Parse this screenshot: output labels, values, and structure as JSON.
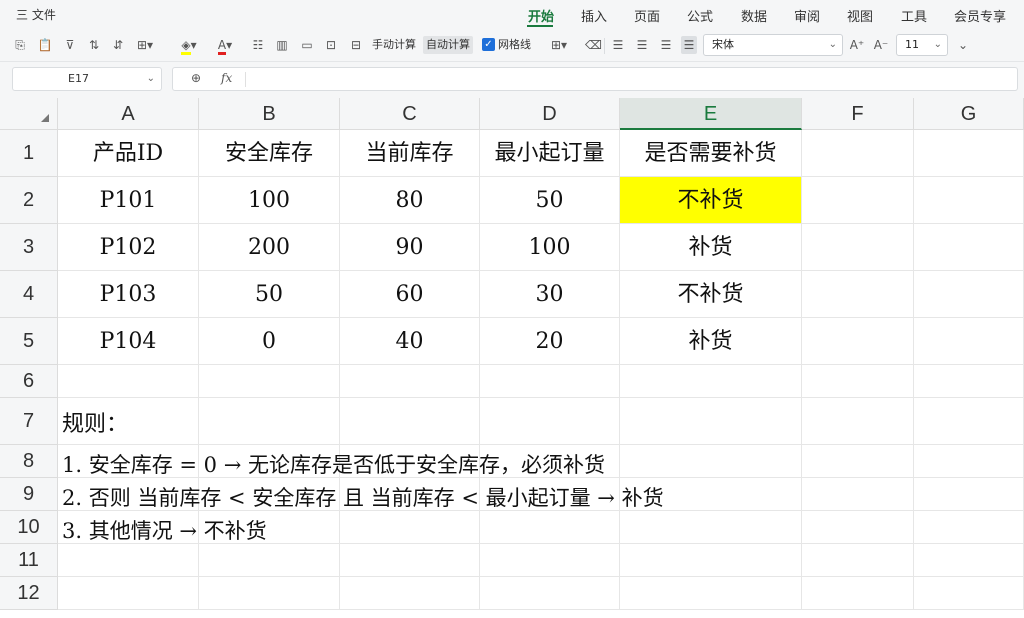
{
  "menu": {
    "file_label": "三 文件",
    "tabs": [
      "开始",
      "插入",
      "页面",
      "公式",
      "数据",
      "审阅",
      "视图",
      "工具",
      "会员专享"
    ],
    "active_tab": "开始"
  },
  "toolbar": {
    "manual_calc": "手动计算",
    "auto_calc": "自动计算",
    "gridlines": "网格线",
    "gridlines_checked": true,
    "font_name": "宋体",
    "font_size": "11",
    "fill_color": "#ffff00",
    "font_color": "#e02020"
  },
  "formula_bar": {
    "cell_ref": "E17",
    "zoom_icon": "⊕",
    "fx_label": "fx",
    "formula": ""
  },
  "grid": {
    "columns": [
      "A",
      "B",
      "C",
      "D",
      "E",
      "F",
      "G"
    ],
    "selected_column": "E",
    "rows": [
      "1",
      "2",
      "3",
      "4",
      "5",
      "6",
      "7",
      "8",
      "9",
      "10",
      "11",
      "12"
    ],
    "header": [
      "产品ID",
      "安全库存",
      "当前库存",
      "最小起订量",
      "是否需要补货"
    ],
    "data": [
      [
        "P101",
        "100",
        "80",
        "50",
        "不补货"
      ],
      [
        "P102",
        "200",
        "90",
        "100",
        "补货"
      ],
      [
        "P103",
        "50",
        "60",
        "30",
        "不补货"
      ],
      [
        "P104",
        "0",
        "40",
        "20",
        "补货"
      ]
    ],
    "highlight_color": "#ffff00",
    "rules_title": "规则：",
    "rules": [
      "1. 安全库存 = 0 → 无论库存是否低于安全库存，必须补货",
      "2. 否则 当前库存 < 安全库存 且 当前库存 < 最小起订量 → 补货",
      "3. 其他情况 → 不补货"
    ]
  }
}
